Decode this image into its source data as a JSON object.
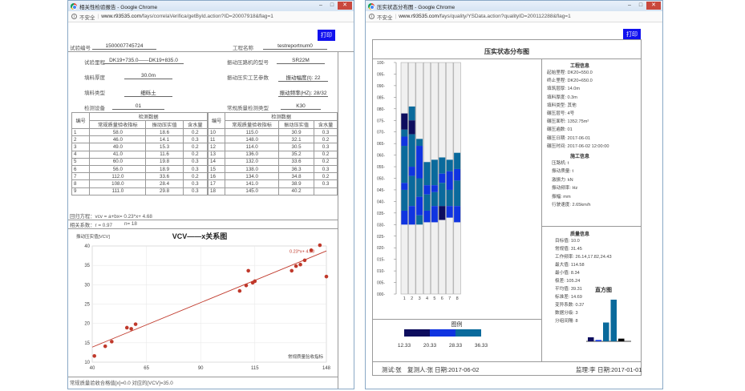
{
  "window1": {
    "title": "相关性检验报告 - Google Chrome",
    "security": "不安全",
    "url_domain": "www.r93535.com",
    "url_path": "/fays/correlaVerifica/getById.action?ID=20007918&flag=1",
    "print_label": "打印",
    "form": {
      "test_no_label": "试验编号",
      "test_no": "1500007745724",
      "project_label": "工程名称",
      "project": "testreportnum0",
      "range_label": "试验里程",
      "range": "DK19+735.0——DK19+835.0",
      "roller_label": "振动压路机的型号",
      "roller": "SR22M",
      "thickness_label": "填料厚度",
      "thickness": "30.0m",
      "process_label": "振动压实工艺参数",
      "amplitude": "振动幅度(t): 22",
      "fill_label": "填料类型",
      "fill": "细砾土",
      "freq": "振动频率(HZ): 28/32",
      "device_label": "检测设备",
      "device": "01",
      "conv_label": "常规质量检测类型",
      "conv": "K30"
    },
    "table": {
      "col_no": "编号",
      "col_data": "检测数据",
      "col_conv": "常规质量验收指标",
      "col_vcv": "振动压实值",
      "col_water": "含水量",
      "left_rows": [
        [
          "1",
          "58.0",
          "18.6",
          "0.2"
        ],
        [
          "2",
          "46.0",
          "14.1",
          "0.3"
        ],
        [
          "3",
          "49.0",
          "15.3",
          "0.2"
        ],
        [
          "4",
          "41.0",
          "11.6",
          "0.2"
        ],
        [
          "5",
          "60.0",
          "19.8",
          "0.3"
        ],
        [
          "6",
          "56.0",
          "18.9",
          "0.3"
        ],
        [
          "7",
          "112.0",
          "33.6",
          "0.2"
        ],
        [
          "8",
          "108.0",
          "28.4",
          "0.3"
        ],
        [
          "9",
          "111.0",
          "29.8",
          "0.3"
        ]
      ],
      "right_rows": [
        [
          "10",
          "115.0",
          "30.9",
          "0.3"
        ],
        [
          "11",
          "148.0",
          "32.1",
          "0.2"
        ],
        [
          "12",
          "114.0",
          "30.5",
          "0.3"
        ],
        [
          "13",
          "136.0",
          "35.2",
          "0.2"
        ],
        [
          "14",
          "132.0",
          "33.6",
          "0.2"
        ],
        [
          "15",
          "138.0",
          "36.3",
          "0.3"
        ],
        [
          "16",
          "134.0",
          "34.8",
          "0.2"
        ],
        [
          "17",
          "141.0",
          "38.9",
          "0.3"
        ],
        [
          "18",
          "145.0",
          "40.2",
          ""
        ]
      ]
    },
    "regression": "回归方程：vcv = a+bx= 0.23*x+ 4.68",
    "correlation": "相关系数：r = 0.97",
    "n_text": "n= 18",
    "bottom_note": "常规质量验收合格值[x]=0.0   对应的[VCV]=35.0",
    "chart_data": {
      "type": "scatter",
      "title": "VCV——x关系图",
      "ylabel": "振动压实值[VCV]",
      "xlabel": "常规质量验收指标",
      "xlim": [
        40,
        148
      ],
      "ylim": [
        10,
        40
      ],
      "xticks": [
        "40",
        "65",
        "90",
        "115",
        "148"
      ],
      "yticks": [
        "10",
        "15",
        "20",
        "25",
        "30",
        "35",
        "40"
      ],
      "points": [
        [
          41,
          11.6
        ],
        [
          46,
          14.1
        ],
        [
          49,
          15.3
        ],
        [
          56,
          18.9
        ],
        [
          58,
          18.6
        ],
        [
          60,
          19.8
        ],
        [
          108,
          28.4
        ],
        [
          111,
          29.8
        ],
        [
          112,
          33.6
        ],
        [
          114,
          30.5
        ],
        [
          115,
          30.9
        ],
        [
          132,
          33.6
        ],
        [
          134,
          34.8
        ],
        [
          136,
          35.2
        ],
        [
          138,
          36.3
        ],
        [
          141,
          38.9
        ],
        [
          145,
          40.2
        ],
        [
          148,
          32.1
        ]
      ],
      "fit": {
        "a": 4.68,
        "b": 0.23
      },
      "annotation": "0.23*x+ 4.68",
      "point_color": "#c0392b"
    }
  },
  "window2": {
    "title": "压实状态分布图 - Google Chrome",
    "security": "不安全",
    "url_domain": "www.r93535.com",
    "url_path": "/fays/quality/YSData.action?qualityID=200112288&flag=1",
    "print_label": "打印",
    "chart_title": "压实状态分布图",
    "y_ticks": [
      "100-",
      "095-",
      "090-",
      "085-",
      "080-",
      "075-",
      "070-",
      "065-",
      "060-",
      "055-",
      "050-",
      "045-",
      "040-",
      "035-",
      "030-",
      "025-",
      "020-",
      "015-",
      "010-",
      "005-",
      "000-"
    ],
    "lanes": [
      "1",
      "2",
      "3",
      "4",
      "5",
      "6",
      "7",
      "8"
    ],
    "legend_title": "图例",
    "legend_values": [
      "12.33",
      "20.33",
      "28.33",
      "36.33"
    ],
    "legend_colors": [
      "#0d0d5e",
      "#1034e0",
      "#0a6a9c"
    ],
    "eng_title": "工程信息",
    "eng_lines": [
      "起始里程: DK20+550.0",
      "终止里程: DK20+650.0",
      "填筑层厚: 14.0m",
      "填料厚度: 0.3m",
      "填料类型: 其他",
      "碾压层号: 4号",
      "碾压面积: 1352.75m²",
      "碾压遍数: 01",
      "碾压日期: 2017-06-01",
      "碾压时间: 2017-06-02 12:00:00"
    ],
    "machine_title": "施工信息",
    "machine_lines": [
      "压路机: t",
      "振动质量: t",
      "激振力: kN",
      "振动频率: Hz",
      "振幅: mm",
      "行驶速度: 2.65km/h"
    ],
    "stat_title": "质量信息",
    "stat_lines": [
      "目标值: 10.0",
      "常规值: 31.45",
      "工作频率: 26.14,17.82,24.43",
      "最大值: 114.58",
      "最小值: 8.34",
      "极差: 105.24",
      "平均值: 39.31",
      "标准差: 14.69",
      "变异系数: 0.37",
      "数据分级: 3",
      "分组间隔: 8"
    ],
    "hist_title": "直方图",
    "hist_values": [
      6,
      2,
      28,
      62,
      4
    ],
    "hist_colors": [
      "#0d0d5e",
      "#1034e0",
      "#0a6a9c",
      "#0a6a9c",
      "#000000"
    ],
    "footer": {
      "tester": "测试:张",
      "reviewer": "复测人:张",
      "date1": "日期:2017-06-02",
      "supervisor": "监理:李",
      "date2": "日期:2017-01-01"
    }
  }
}
